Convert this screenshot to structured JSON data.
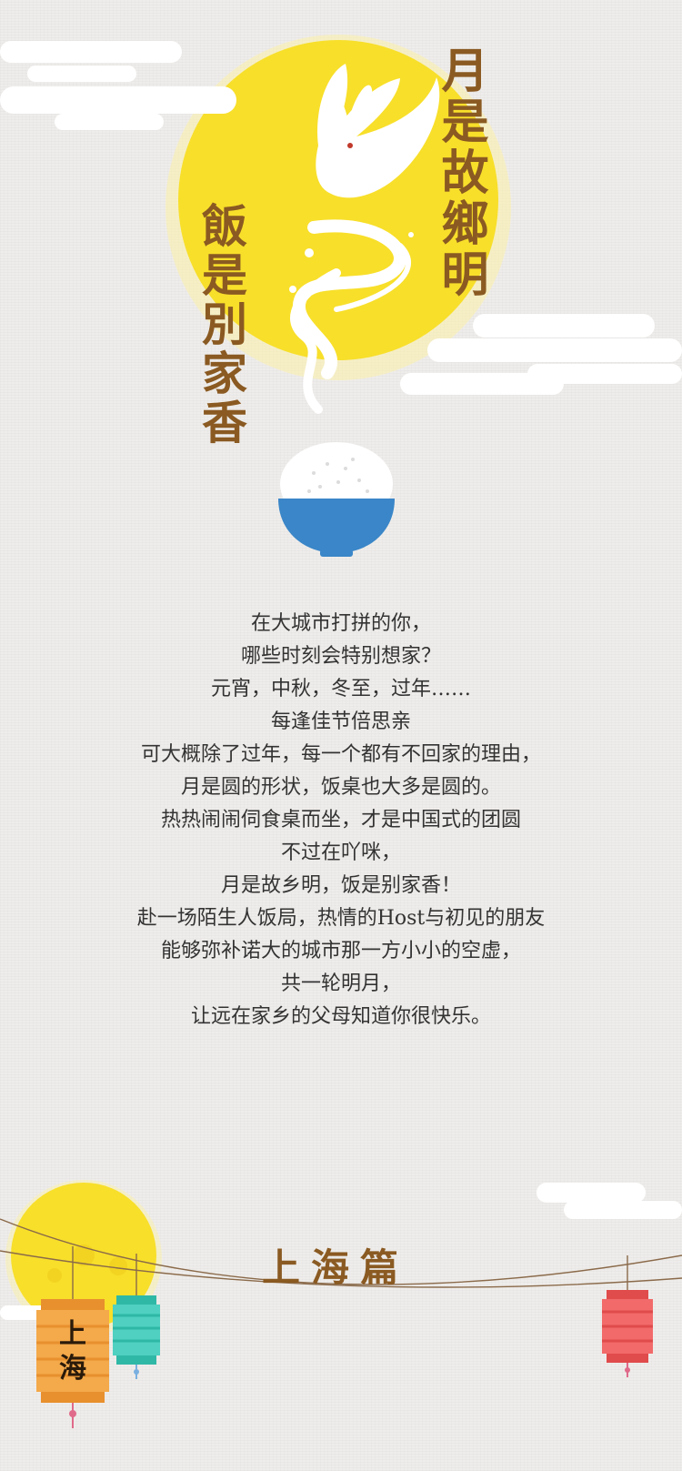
{
  "hero": {
    "title_right": "月是故鄉明",
    "title_left": "飯是別家香"
  },
  "poem": {
    "lines": [
      "在大城市打拼的你，",
      "哪些时刻会特别想家？",
      "元宵，中秋，冬至，过年……",
      "每逢佳节倍思亲",
      "可大概除了过年，每一个都有不回家的理由，",
      "月是圆的形状，饭桌也大多是圆的。",
      "热热闹闹伺食桌而坐，才是中国式的团圆",
      "不过在吖咪，",
      "月是故乡明，饭是别家香！",
      "赴一场陌生人饭局，热情的Host与初见的朋友",
      "能够弥补诺大的城市那一方小小的空虚，",
      "共一轮明月，",
      "让远在家乡的父母知道你很快乐。"
    ]
  },
  "section": {
    "title": "上海篇",
    "lantern_label": [
      "上",
      "海"
    ]
  },
  "colors": {
    "moon": "#f8df2a",
    "title": "#8a5a22",
    "bowl": "#3a86c8",
    "lantern_orange": "#f4a94a",
    "lantern_teal": "#4fd0c0",
    "lantern_red": "#f26a6a"
  }
}
